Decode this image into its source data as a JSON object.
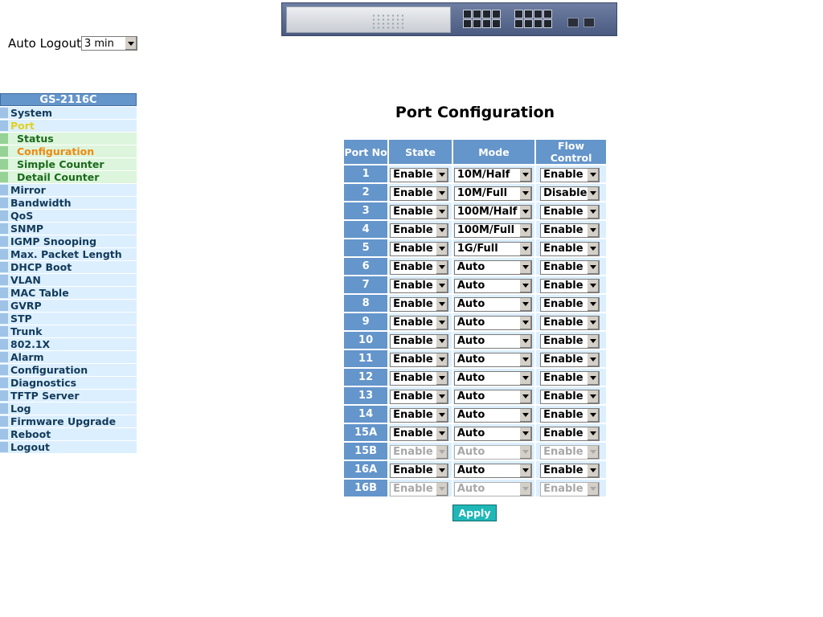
{
  "auto_logout": {
    "label": "Auto Logout",
    "value": "3 min"
  },
  "sidebar": {
    "title": "GS-2116C",
    "items": [
      {
        "label": "System",
        "level": 0,
        "state": ""
      },
      {
        "label": "Port",
        "level": 0,
        "state": "open"
      },
      {
        "label": "Status",
        "level": 1,
        "state": ""
      },
      {
        "label": "Configuration",
        "level": 1,
        "state": "active"
      },
      {
        "label": "Simple Counter",
        "level": 1,
        "state": ""
      },
      {
        "label": "Detail Counter",
        "level": 1,
        "state": ""
      },
      {
        "label": "Mirror",
        "level": 0,
        "state": ""
      },
      {
        "label": "Bandwidth",
        "level": 0,
        "state": ""
      },
      {
        "label": "QoS",
        "level": 0,
        "state": ""
      },
      {
        "label": "SNMP",
        "level": 0,
        "state": ""
      },
      {
        "label": "IGMP Snooping",
        "level": 0,
        "state": ""
      },
      {
        "label": "Max. Packet Length",
        "level": 0,
        "state": ""
      },
      {
        "label": "DHCP Boot",
        "level": 0,
        "state": ""
      },
      {
        "label": "VLAN",
        "level": 0,
        "state": ""
      },
      {
        "label": "MAC Table",
        "level": 0,
        "state": ""
      },
      {
        "label": "GVRP",
        "level": 0,
        "state": ""
      },
      {
        "label": "STP",
        "level": 0,
        "state": ""
      },
      {
        "label": "Trunk",
        "level": 0,
        "state": ""
      },
      {
        "label": "802.1X",
        "level": 0,
        "state": ""
      },
      {
        "label": "Alarm",
        "level": 0,
        "state": ""
      },
      {
        "label": "Configuration",
        "level": 0,
        "state": ""
      },
      {
        "label": "Diagnostics",
        "level": 0,
        "state": ""
      },
      {
        "label": "TFTP Server",
        "level": 0,
        "state": ""
      },
      {
        "label": "Log",
        "level": 0,
        "state": ""
      },
      {
        "label": "Firmware Upgrade",
        "level": 0,
        "state": ""
      },
      {
        "label": "Reboot",
        "level": 0,
        "state": ""
      },
      {
        "label": "Logout",
        "level": 0,
        "state": ""
      }
    ]
  },
  "main": {
    "title": "Port Configuration",
    "columns": [
      "Port No",
      "State",
      "Mode",
      "Flow Control"
    ],
    "rows": [
      {
        "port": "1",
        "state": "Enable",
        "mode": "10M/Half",
        "flow": "Enable",
        "disabled": false
      },
      {
        "port": "2",
        "state": "Enable",
        "mode": "10M/Full",
        "flow": "Disable",
        "disabled": false
      },
      {
        "port": "3",
        "state": "Enable",
        "mode": "100M/Half",
        "flow": "Enable",
        "disabled": false
      },
      {
        "port": "4",
        "state": "Enable",
        "mode": "100M/Full",
        "flow": "Enable",
        "disabled": false
      },
      {
        "port": "5",
        "state": "Enable",
        "mode": "1G/Full",
        "flow": "Enable",
        "disabled": false
      },
      {
        "port": "6",
        "state": "Enable",
        "mode": "Auto",
        "flow": "Enable",
        "disabled": false
      },
      {
        "port": "7",
        "state": "Enable",
        "mode": "Auto",
        "flow": "Enable",
        "disabled": false
      },
      {
        "port": "8",
        "state": "Enable",
        "mode": "Auto",
        "flow": "Enable",
        "disabled": false
      },
      {
        "port": "9",
        "state": "Enable",
        "mode": "Auto",
        "flow": "Enable",
        "disabled": false
      },
      {
        "port": "10",
        "state": "Enable",
        "mode": "Auto",
        "flow": "Enable",
        "disabled": false
      },
      {
        "port": "11",
        "state": "Enable",
        "mode": "Auto",
        "flow": "Enable",
        "disabled": false
      },
      {
        "port": "12",
        "state": "Enable",
        "mode": "Auto",
        "flow": "Enable",
        "disabled": false
      },
      {
        "port": "13",
        "state": "Enable",
        "mode": "Auto",
        "flow": "Enable",
        "disabled": false
      },
      {
        "port": "14",
        "state": "Enable",
        "mode": "Auto",
        "flow": "Enable",
        "disabled": false
      },
      {
        "port": "15A",
        "state": "Enable",
        "mode": "Auto",
        "flow": "Enable",
        "disabled": false
      },
      {
        "port": "15B",
        "state": "Enable",
        "mode": "Auto",
        "flow": "Enable",
        "disabled": true
      },
      {
        "port": "16A",
        "state": "Enable",
        "mode": "Auto",
        "flow": "Enable",
        "disabled": false
      },
      {
        "port": "16B",
        "state": "Enable",
        "mode": "Auto",
        "flow": "Enable",
        "disabled": true
      }
    ],
    "apply_label": "Apply"
  },
  "colors": {
    "header_blue": "#6495cb",
    "menu_bg": "#dcefff",
    "submenu_bg": "#dcf5dc",
    "open_item": "#e2d020",
    "active_item": "#ef8a10",
    "apply_button": "#20b7b7"
  }
}
